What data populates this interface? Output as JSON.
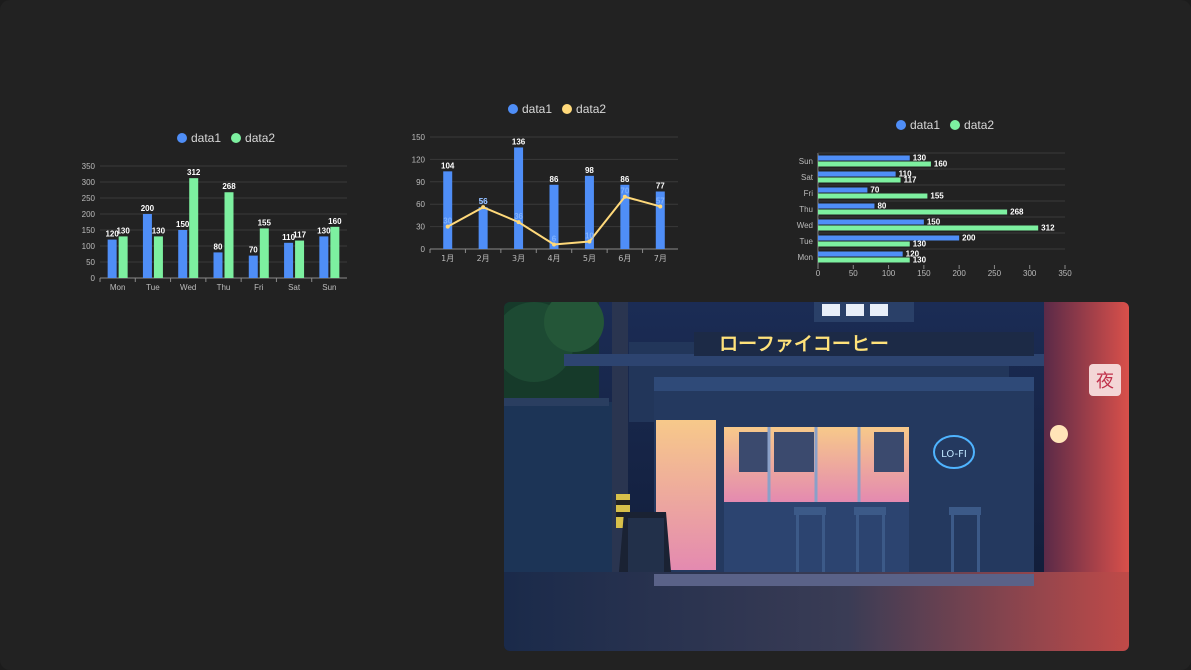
{
  "colors": {
    "data1": "#4f8ef7",
    "data2": "#7df0a0",
    "line2": "#ffd97a",
    "background": "#222222",
    "axis": "#8a8a8a",
    "grid": "#3a3a3a",
    "label": "#ffffff"
  },
  "chart_data": [
    {
      "type": "bar",
      "orientation": "vertical",
      "legend": [
        "data1",
        "data2"
      ],
      "legend_position": "top-center",
      "categories": [
        "Mon",
        "Tue",
        "Wed",
        "Thu",
        "Fri",
        "Sat",
        "Sun"
      ],
      "series": [
        {
          "name": "data1",
          "values": [
            120,
            200,
            150,
            80,
            70,
            110,
            130
          ]
        },
        {
          "name": "data2",
          "values": [
            130,
            130,
            312,
            268,
            155,
            117,
            160
          ]
        }
      ],
      "yticks": [
        "0",
        "50",
        "100",
        "150",
        "200",
        "250",
        "300",
        "350"
      ],
      "ylim": [
        0,
        350
      ],
      "grid": true
    },
    {
      "type": "bar",
      "orientation": "vertical",
      "legend": [
        "data1",
        "data2"
      ],
      "legend_position": "top-center",
      "categories": [
        "1月",
        "2月",
        "3月",
        "4月",
        "5月",
        "6月",
        "7月"
      ],
      "series": [
        {
          "name": "data1",
          "type": "bar",
          "values": [
            104,
            56,
            136,
            86,
            98,
            86,
            77
          ]
        },
        {
          "name": "data2",
          "type": "line",
          "values": [
            30,
            56,
            36,
            6,
            10,
            70,
            57
          ]
        }
      ],
      "yticks": [
        "0",
        "30",
        "60",
        "90",
        "120",
        "150"
      ],
      "ylim": [
        0,
        150
      ],
      "grid": true
    },
    {
      "type": "bar",
      "orientation": "horizontal",
      "legend": [
        "data1",
        "data2"
      ],
      "legend_position": "top-center",
      "categories": [
        "Mon",
        "Tue",
        "Wed",
        "Thu",
        "Fri",
        "Sat",
        "Sun"
      ],
      "series": [
        {
          "name": "data1",
          "values": [
            120,
            200,
            150,
            80,
            70,
            110,
            130
          ]
        },
        {
          "name": "data2",
          "values": [
            130,
            130,
            312,
            268,
            155,
            117,
            160
          ]
        }
      ],
      "xticks": [
        "0",
        "50",
        "100",
        "150",
        "200",
        "250",
        "300",
        "350"
      ],
      "xlim": [
        0,
        350
      ],
      "grid": true
    }
  ],
  "photo": {
    "neon_sign": "ローファイコーヒー",
    "cup_sign": "LO-FI",
    "lantern": "夜"
  }
}
